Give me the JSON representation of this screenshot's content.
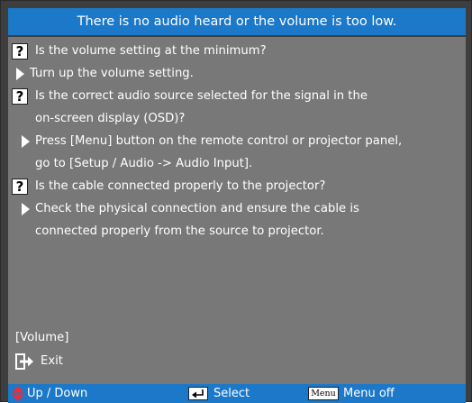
{
  "title": "There is no audio heard or the volume is too low.",
  "items": [
    {
      "kind": "question",
      "text": "Is the volume setting at the minimum?"
    },
    {
      "kind": "answer",
      "text": "Turn up the volume setting."
    },
    {
      "kind": "question",
      "text": "Is the correct audio source selected for the signal in the"
    },
    {
      "kind": "continuation",
      "text": "on-screen display (OSD)?"
    },
    {
      "kind": "answer",
      "text": "Press [Menu] button on the remote control or projector panel,"
    },
    {
      "kind": "continuation",
      "text": "go to [Setup / Audio -> Audio Input]."
    },
    {
      "kind": "question",
      "text": "Is the cable connected properly to the projector?"
    },
    {
      "kind": "answer",
      "text": "Check the physical connection and ensure the cable is"
    },
    {
      "kind": "continuation",
      "text": "connected properly from the source to projector."
    }
  ],
  "footer": {
    "section_label": "[Volume]",
    "exit_label": "Exit"
  },
  "nav": {
    "up_down_label": "Up / Down",
    "select_label": "Select",
    "menu_key_label": "Menu",
    "menu_off_label": "Menu off"
  },
  "colors": {
    "title_bar": "#1c78c8",
    "content_bg": "#787878",
    "frame": "#3e3e3e",
    "updown_icon": "#e8303a"
  }
}
